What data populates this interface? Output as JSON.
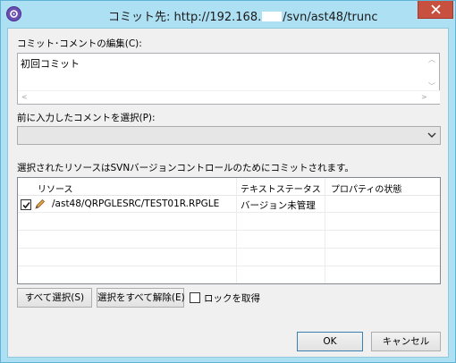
{
  "window": {
    "title_prefix": "コミット先: http://192.168.",
    "title_suffix": "/svn/ast48/trunc"
  },
  "comment": {
    "label": "コミット･コメントの編集(C):",
    "value": "初回コミット"
  },
  "previous": {
    "label": "前に入力したコメントを選択(P):",
    "selected": ""
  },
  "resources": {
    "label": "選択されたリソースはSVNバージョンコントロールのためにコミットされます。",
    "columns": [
      "リソース",
      "テキストステータス",
      "プロパティの状態"
    ],
    "rows": [
      {
        "checked": true,
        "icon": "pencil-icon",
        "resource": "/ast48/QRPGLESRC/TEST01R.RPGLE",
        "text_status": "バージョン未管理",
        "prop_status": ""
      }
    ]
  },
  "buttons": {
    "select_all": "すべて選択(S)",
    "deselect_all": "選択をすべて解除(E)",
    "lock_label": "ロックを取得",
    "ok": "OK",
    "cancel": "キャンセル"
  },
  "colors": {
    "frame": "#aee0f3",
    "close": "#c7503f",
    "client": "#f0f0f0"
  }
}
